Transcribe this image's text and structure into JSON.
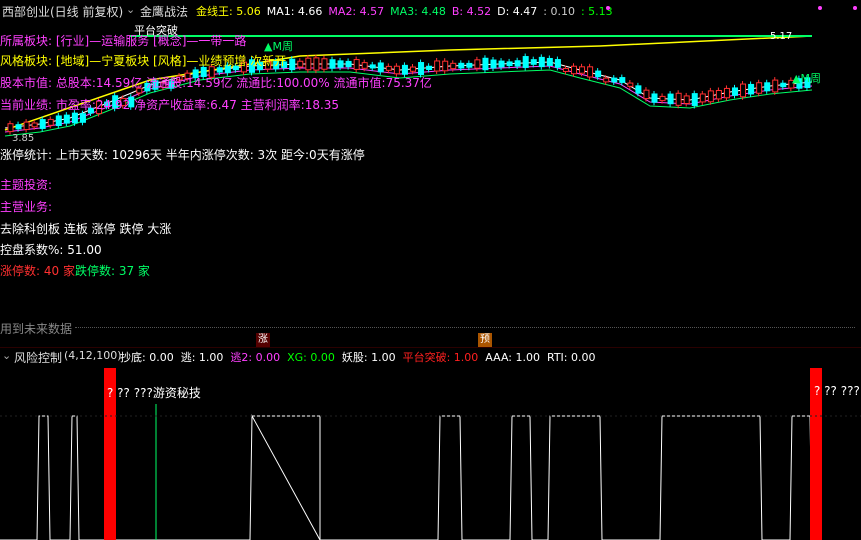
{
  "header": {
    "title": "西部创业(日线 前复权)",
    "indicator_name": "金鹰战法",
    "readouts": [
      {
        "label": "金线王:",
        "value": "5.06",
        "color": "#ffff00"
      },
      {
        "label": "MA1:",
        "value": "4.66",
        "color": "#ffffff"
      },
      {
        "label": "MA2:",
        "value": "4.57",
        "color": "#ff40ff"
      },
      {
        "label": "MA3:",
        "value": "4.48",
        "color": "#00ff66"
      },
      {
        "label": "B:",
        "value": "4.52",
        "color": "#ff40ff"
      },
      {
        "label": "D:",
        "value": "4.47",
        "color": "#ffffff"
      },
      {
        "label": ":",
        "value": "0.10",
        "color": "#cccccc"
      },
      {
        "label": ":",
        "value": "5.13",
        "color": "#00ff00"
      }
    ]
  },
  "chart_labels": {
    "platform_break": "平台突破",
    "m_week_1": "▲M周",
    "m_week_2": "▲M周",
    "price_high": "5.17",
    "price_low": "3.85"
  },
  "info": {
    "sector": "所属板块: [行业]—运输服务 [概念]—一带一路",
    "style": "风格板块: [地域]—宁夏板块 [风格]—业绩预增 次新开",
    "equity": "股本市值: 总股本:14.59亿 流通股:14.59亿 流通比:100.00% 流通市值:75.37亿",
    "performance": "当前业绩: 市盈率:24.92 净资产收益率:6.47 主营利润率:18.35",
    "limit_stats": "涨停统计: 上市天数: 10296天  半年内涨停次数: 3次    距今:0天有涨停",
    "theme": "主题投资:",
    "main_business": "主营业务:",
    "filter": "去除科创板 连板 涨停 跌停 大涨",
    "control": "控盘系数%: 51.00",
    "up_count_label": "涨停数:",
    "up_count_value": "40 家",
    "down_count_label": "跌停数:",
    "down_count_value": "37 家",
    "future_data": "用到未来数据"
  },
  "markers": {
    "up": "涨",
    "pre": "预"
  },
  "lower": {
    "name": "风险控制",
    "params": "(4,12,100)",
    "readouts": [
      {
        "text": "抄底: 0.00",
        "color": "#ffffff"
      },
      {
        "text": "逃: 1.00",
        "color": "#ffffff"
      },
      {
        "text": "逃2: 0.00",
        "color": "#ff40ff"
      },
      {
        "text": "XG: 0.00",
        "color": "#00ff00"
      },
      {
        "text": "妖股: 1.00",
        "color": "#ffffff"
      },
      {
        "text": "平台突破: 1.00",
        "color": "#ff2020"
      },
      {
        "text": "AAA: 1.00",
        "color": "#ffffff"
      },
      {
        "text": "RTI: 0.00",
        "color": "#ffffff"
      }
    ],
    "label_left": "? ?? ???游资秘技",
    "label_right": "? ?? ???"
  },
  "colors": {
    "up": "#ff3030",
    "down": "#00ffff",
    "ma_yellow": "#ffff00",
    "ma_white": "#ffffff",
    "ma_magenta": "#ff40ff",
    "ma_green": "#00ff66",
    "cyan_text": "#ff40ff"
  }
}
